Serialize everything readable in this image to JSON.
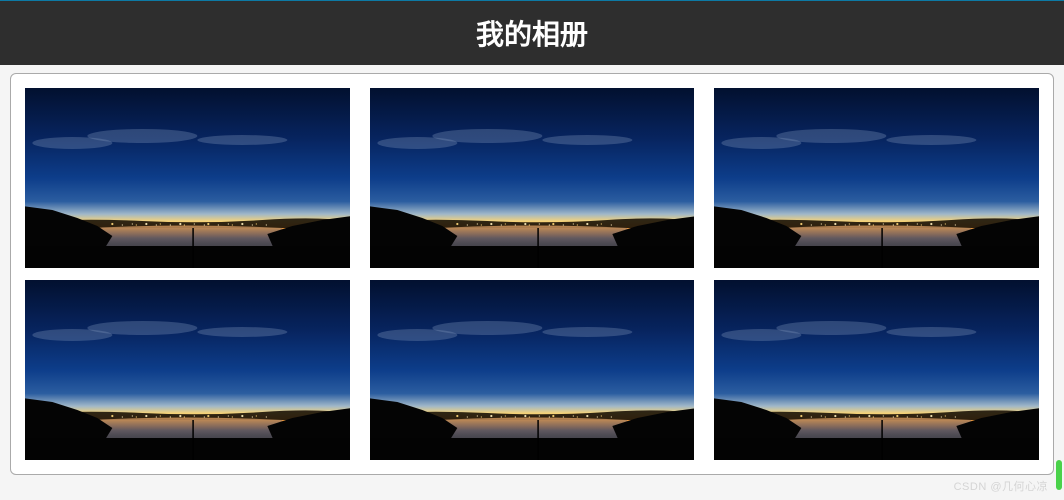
{
  "header": {
    "title": "我的相册"
  },
  "gallery": {
    "rows": 2,
    "cols": 3,
    "alt": "sunset-landscape"
  },
  "watermark": {
    "text": "CSDN @几何心凉"
  }
}
